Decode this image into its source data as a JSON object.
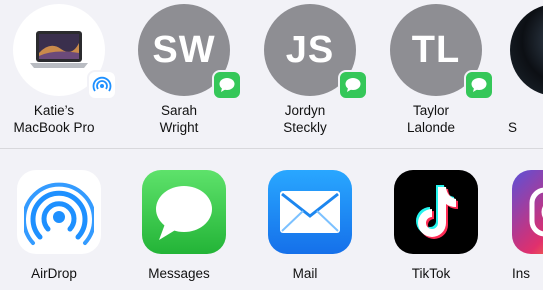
{
  "people": [
    {
      "line1": "Katie’s",
      "line2": "MacBook Pro",
      "type": "device",
      "badge": "airdrop-icon"
    },
    {
      "initials": "SW",
      "line1": "Sarah",
      "line2": "Wright",
      "type": "contact",
      "badge": "message-icon"
    },
    {
      "initials": "JS",
      "line1": "Jordyn",
      "line2": "Steckly",
      "type": "contact",
      "badge": "message-icon"
    },
    {
      "initials": "TL",
      "line1": "Taylor",
      "line2": "Lalonde",
      "type": "contact",
      "badge": "message-icon"
    },
    {
      "line1": "S",
      "line2": "",
      "type": "photo"
    }
  ],
  "apps": [
    {
      "label": "AirDrop",
      "icon": "airdrop-icon"
    },
    {
      "label": "Messages",
      "icon": "messages-icon"
    },
    {
      "label": "Mail",
      "icon": "mail-icon"
    },
    {
      "label": "TikTok",
      "icon": "tiktok-icon"
    },
    {
      "label": "Ins",
      "icon": "instagram-icon"
    }
  ],
  "colors": {
    "background": "#f2f2f7",
    "contact_avatar": "#8e8e93",
    "message_badge": "#35c759",
    "airdrop_blue": "#1e90ff"
  }
}
